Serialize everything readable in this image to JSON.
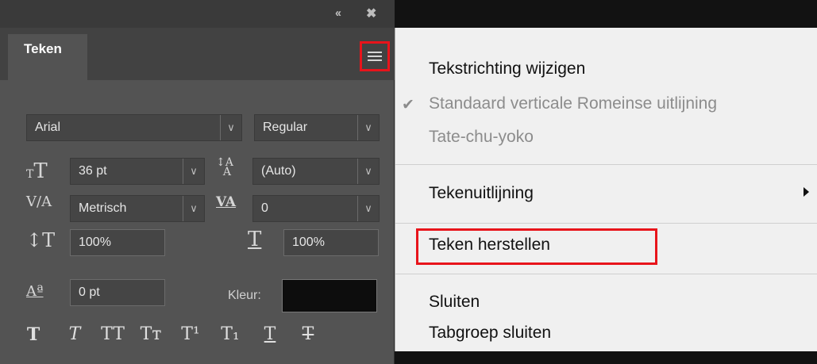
{
  "panel": {
    "collapse_icon": "double-chevron-left",
    "close_icon": "close-x",
    "tab_label": "Teken",
    "menu_icon": "hamburger-menu",
    "font_family": "Arial",
    "font_style": "Regular",
    "font_size": "36 pt",
    "leading": "(Auto)",
    "kerning": "Metrisch",
    "tracking": "0",
    "vertical_scale": "100%",
    "horizontal_scale": "100%",
    "baseline_shift": "0 pt",
    "color_label": "Kleur:",
    "color_value": "#0d0d0d",
    "format_buttons": [
      "T",
      "T",
      "TT",
      "Tт",
      "T¹",
      "T₁",
      "T",
      "T"
    ]
  },
  "menu": {
    "items": [
      {
        "label": "Tekstrichting wijzigen",
        "enabled": true
      },
      {
        "label": "Standaard verticale Romeinse uitlijning",
        "enabled": false,
        "checked": true
      },
      {
        "label": "Tate-chu-yoko",
        "enabled": false
      },
      {
        "label": "Tekenuitlijning",
        "enabled": true,
        "submenu": true
      },
      {
        "label": "Teken herstellen",
        "enabled": true,
        "highlighted": true
      },
      {
        "label": "Sluiten",
        "enabled": true
      },
      {
        "label": "Tabgroep sluiten",
        "enabled": true
      }
    ],
    "check_mark": "✔",
    "highlight_color": "#e8141b"
  }
}
